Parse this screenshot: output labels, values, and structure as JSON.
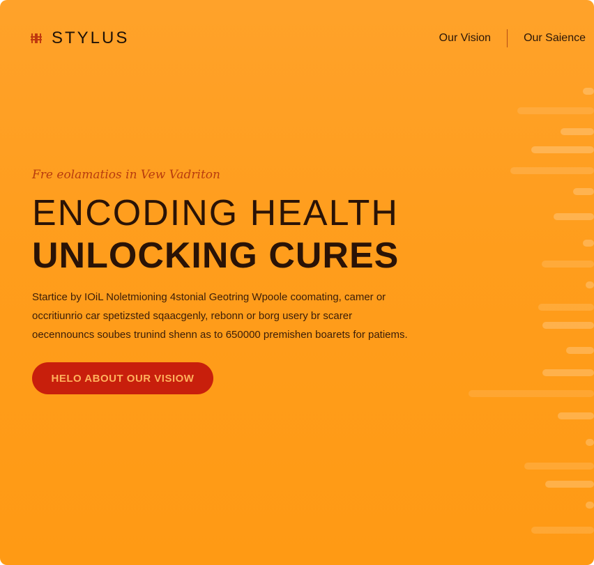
{
  "brand": {
    "name": "STYLUS",
    "logo_icon": "double-h-logo-icon",
    "logo_color": "#c0390f"
  },
  "nav": {
    "items": [
      {
        "label": "Our Vision"
      },
      {
        "label": "Our Saience"
      }
    ]
  },
  "hero": {
    "tagline": "Fre eolamatios in Vew Vadriton",
    "title_line1": "ENCODING HEALTH",
    "title_line2": "UNLOCKING CURES",
    "description_lines": [
      "Startice by IOiL Noletmioning 4stonial Geotring Wpoole coomating, camer or",
      "occritiunrio car spetizsted sqaacgenly, rebonn or borg usery br scarer",
      "oecennouncs soubes trunind shenn as to 650000 premishen boarets for patiems."
    ],
    "cta_label": "HELO ABOUT OUR VISIOW"
  },
  "colors": {
    "background": "#ff9d1c",
    "text_dark": "#2a1306",
    "accent_red": "#c81f0c",
    "tagline": "#b83c0e"
  }
}
